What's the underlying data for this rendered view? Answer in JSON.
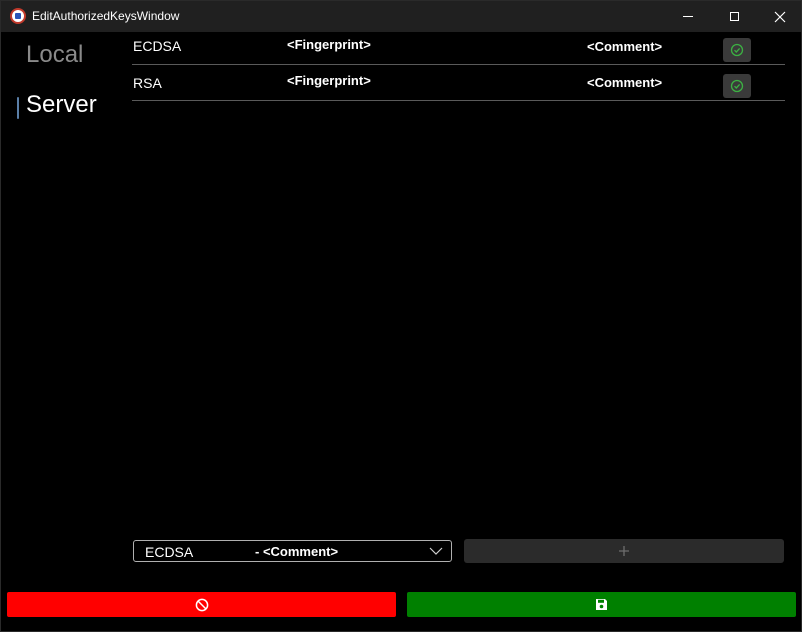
{
  "window": {
    "title": "EditAuthorizedKeysWindow"
  },
  "nav": {
    "items": [
      {
        "label": "Local",
        "selected": false
      },
      {
        "label": "Server",
        "selected": true
      }
    ]
  },
  "keys": [
    {
      "type": "ECDSA",
      "fingerprint": "<Fingerprint>",
      "comment": "<Comment>"
    },
    {
      "type": "RSA",
      "fingerprint": "<Fingerprint>",
      "comment": "<Comment>"
    }
  ],
  "add_key": {
    "selected_type": "ECDSA",
    "selected_comment": "- <Comment>",
    "add_icon": "plus-icon"
  },
  "footer": {
    "cancel_icon": "prohibited-icon",
    "save_icon": "save-icon"
  },
  "colors": {
    "cancel": "#ff0000",
    "save": "#008000",
    "check": "#3cb043",
    "background": "#000000"
  }
}
